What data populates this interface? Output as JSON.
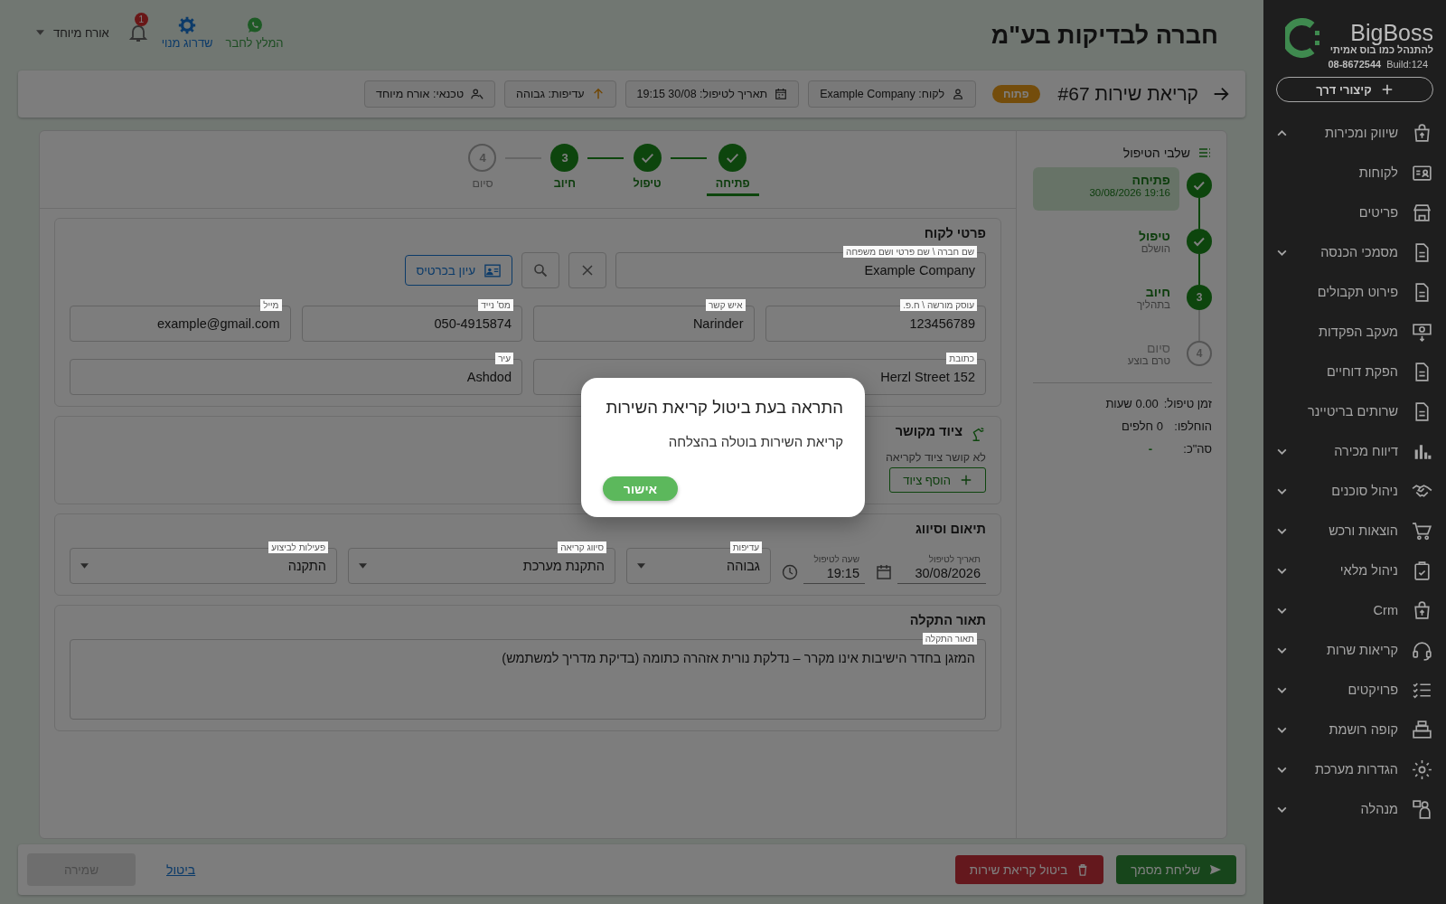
{
  "sidebar": {
    "brand": "BigBoss",
    "slogan": "להתנהל כמו בוס אמיתי",
    "phone": "08-8672544",
    "build": "Build:124",
    "shortcuts": "קיצורי דרך",
    "items": [
      {
        "label": "שיווק ומכירות",
        "expanded": true,
        "children": [
          {
            "label": "לקוחות",
            "kind": "link"
          },
          {
            "label": "פריטים",
            "kind": "link"
          },
          {
            "label": "מסמכי הכנסה",
            "kind": "folder",
            "expanded": false
          },
          {
            "label": "פירוט תקבולים",
            "kind": "link"
          },
          {
            "label": "מעקב הפקדות",
            "kind": "link"
          },
          {
            "label": "הפקת דוחיים",
            "kind": "link"
          },
          {
            "label": "שרותים בריטיינר",
            "kind": "link"
          },
          {
            "label": "דיווח מכירה",
            "kind": "folder",
            "expanded": false
          }
        ]
      },
      {
        "label": "ניהול סוכנים",
        "expanded": false
      },
      {
        "label": "הוצאות ורכש",
        "expanded": false
      },
      {
        "label": "ניהול מלאי",
        "expanded": false
      },
      {
        "label": "Crm",
        "expanded": false
      },
      {
        "label": "קריאות שרות",
        "expanded": false
      },
      {
        "label": "פרויקטים",
        "expanded": false
      },
      {
        "label": "קופה רושמת",
        "expanded": false
      },
      {
        "label": "הגדרות מערכת",
        "expanded": false
      },
      {
        "label": "מנהלה",
        "expanded": false
      }
    ]
  },
  "header": {
    "title": "חברה לבדיקות בע\"מ",
    "refer": "המלץ לחבר",
    "upgrade": "שדרוג מנוי",
    "notifications": "1",
    "user": "אורח מיוחד"
  },
  "call": {
    "title": "קריאת שירות #67",
    "status": "פתוח",
    "chips": [
      {
        "kind": "customer",
        "text": "לקוח: Example Company"
      },
      {
        "kind": "date",
        "text": "תאריך לטיפול: 30/08 19:15"
      },
      {
        "kind": "priority",
        "text": "עדיפות: גבוהה"
      },
      {
        "kind": "technician",
        "text": "טכנאי: אורח מיוחד"
      }
    ]
  },
  "steps_panel": {
    "title": "שלבי הטיפול",
    "steps": [
      {
        "title": "פתיחה",
        "subtitle": "19:16 30/08/2026",
        "kind": "done",
        "selected": true
      },
      {
        "title": "טיפול",
        "subtitle": "הושלם",
        "kind": "done",
        "selected": false
      },
      {
        "title": "חיוב",
        "subtitle": "בתהליך",
        "kind": "current",
        "number": "3",
        "selected": false
      },
      {
        "title": "סיום",
        "subtitle": "טרם בוצע",
        "kind": "pending",
        "number": "4",
        "selected": false
      }
    ],
    "summary": [
      {
        "label": "זמן טיפול:",
        "value": "0.00 שעות"
      },
      {
        "label": "הוחלפו:",
        "value": "0 חלפים"
      },
      {
        "label": "סה\"כ:",
        "value": "-"
      }
    ]
  },
  "stepper": [
    {
      "label": "פתיחה",
      "kind": "done",
      "selected": true
    },
    {
      "label": "טיפול",
      "kind": "done",
      "selected": false
    },
    {
      "label": "חיוב",
      "kind": "current",
      "number": "3",
      "selected": false
    },
    {
      "label": "סיום",
      "kind": "pending",
      "number": "4",
      "selected": false
    }
  ],
  "customer": {
    "title": "פרטי לקוח",
    "name": {
      "label": "שם חברה \\ שם פרטי ושם משפחה",
      "value": "Example Company"
    },
    "view_card": "עיון בכרטיס",
    "fields": [
      {
        "label": "עוסק מורשה \\ ח.פ.",
        "value": "123456789"
      },
      {
        "label": "איש קשר",
        "value": "Narinder"
      },
      {
        "label": "מס' נייד",
        "value": "050-4915874"
      },
      {
        "label": "מייל",
        "value": "example@gmail.com"
      },
      {
        "label": "כתובת",
        "value": "Herzl Street 152"
      },
      {
        "label": "עיר",
        "value": "Ashdod"
      }
    ]
  },
  "equipment": {
    "title": "ציוד מקושר",
    "empty": "לא קושר ציוד לקריאה",
    "add": "הוסף ציוד"
  },
  "scheduling": {
    "title": "תיאום וסיווג",
    "fields": [
      {
        "kind": "date",
        "label": "תאריך לטיפול",
        "value": "30/08/2026"
      },
      {
        "kind": "time",
        "label": "שעה לטיפול",
        "value": "19:15"
      },
      {
        "kind": "select",
        "label": "עדיפות",
        "value": "גבוהה"
      },
      {
        "kind": "select",
        "label": "סיווג קריאה",
        "value": "התקנת מערכת"
      },
      {
        "kind": "select",
        "label": "פעילות לביצוע",
        "value": "התקנה"
      }
    ]
  },
  "fault": {
    "title": "תאור התקלה",
    "label": "תאור התקלה",
    "value": "המזגן בחדר הישיבות אינו מקרר – נדלקת נורית אזהרה כתומה (בדיקת מדריך למשתמש)"
  },
  "footer": {
    "send": "שליחת מסמך",
    "cancel_call": "ביטול קריאת שירות",
    "cancel": "ביטול",
    "save": "שמירה",
    "save_disabled": true
  },
  "dialog": {
    "title": "התראה בעת ביטול קריאת השירות",
    "message": "קריאת השירות בוטלה בהצלחה",
    "ok": "אישור"
  }
}
